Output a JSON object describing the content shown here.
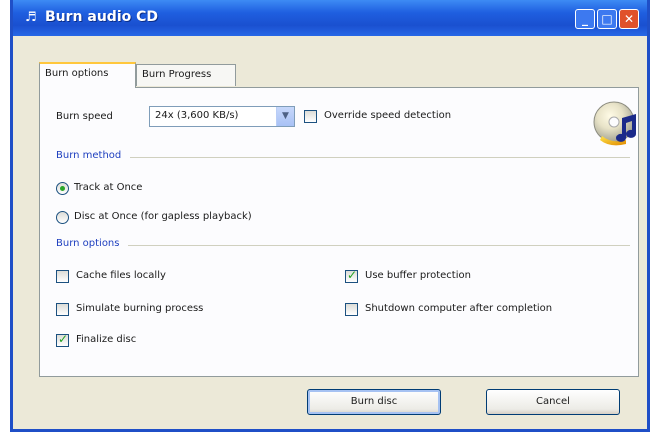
{
  "window": {
    "title": "Burn audio CD"
  },
  "tabs": [
    {
      "label": "Burn options",
      "active": true
    },
    {
      "label": "Burn Progress",
      "active": false
    }
  ],
  "burn_speed": {
    "label": "Burn speed",
    "selected": "24x (3,600 KB/s)",
    "override_label": "Override speed detection",
    "override_checked": false
  },
  "burn_method": {
    "heading": "Burn method",
    "options": [
      {
        "label": "Track at Once",
        "selected": true
      },
      {
        "label": "Disc at Once (for gapless playback)",
        "selected": false
      }
    ]
  },
  "burn_options": {
    "heading": "Burn options",
    "items": [
      {
        "label": "Cache files locally",
        "checked": false
      },
      {
        "label": "Simulate burning process",
        "checked": false
      },
      {
        "label": "Finalize disc",
        "checked": true
      },
      {
        "label": "Use buffer protection",
        "checked": true
      },
      {
        "label": "Shutdown computer after completion",
        "checked": false
      }
    ]
  },
  "buttons": {
    "burn": "Burn disc",
    "cancel": "Cancel"
  },
  "icons": {
    "app": "cd-icon",
    "music": "music-note-icon"
  },
  "colors": {
    "titlebar": "#1f5fe0",
    "section_heading": "#1e3fbf",
    "check": "#21a121"
  }
}
